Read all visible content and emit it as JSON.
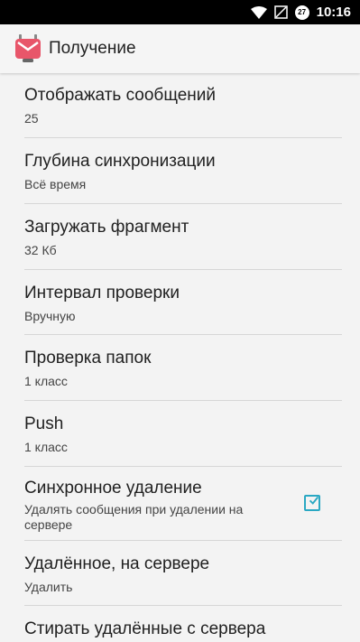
{
  "status_bar": {
    "time": "10:16",
    "notification_count": "27",
    "icons": [
      "wifi-icon",
      "signal-off-icon",
      "notification-badge-icon"
    ]
  },
  "app_bar": {
    "title": "Получение",
    "icon": "k9-mail-logo-icon"
  },
  "colors": {
    "accent": "#2aa8c3",
    "logo": "#e8566a",
    "background": "#f3f3f3"
  },
  "preferences": [
    {
      "title": "Отображать сообщений",
      "summary": "25"
    },
    {
      "title": "Глубина синхронизации",
      "summary": "Всё время"
    },
    {
      "title": "Загружать фрагмент",
      "summary": "32 Кб"
    },
    {
      "title": "Интервал проверки",
      "summary": "Вручную"
    },
    {
      "title": "Проверка папок",
      "summary": "1 класс"
    },
    {
      "title": "Push",
      "summary": "1 класс"
    },
    {
      "title": "Синхронное удаление",
      "summary": "Удалять сообщения при удалении на сервере",
      "checked": true
    },
    {
      "title": "Удалённое, на сервере",
      "summary": "Удалить"
    },
    {
      "title": "Стирать удалённые с сервера",
      "summary": ""
    }
  ]
}
